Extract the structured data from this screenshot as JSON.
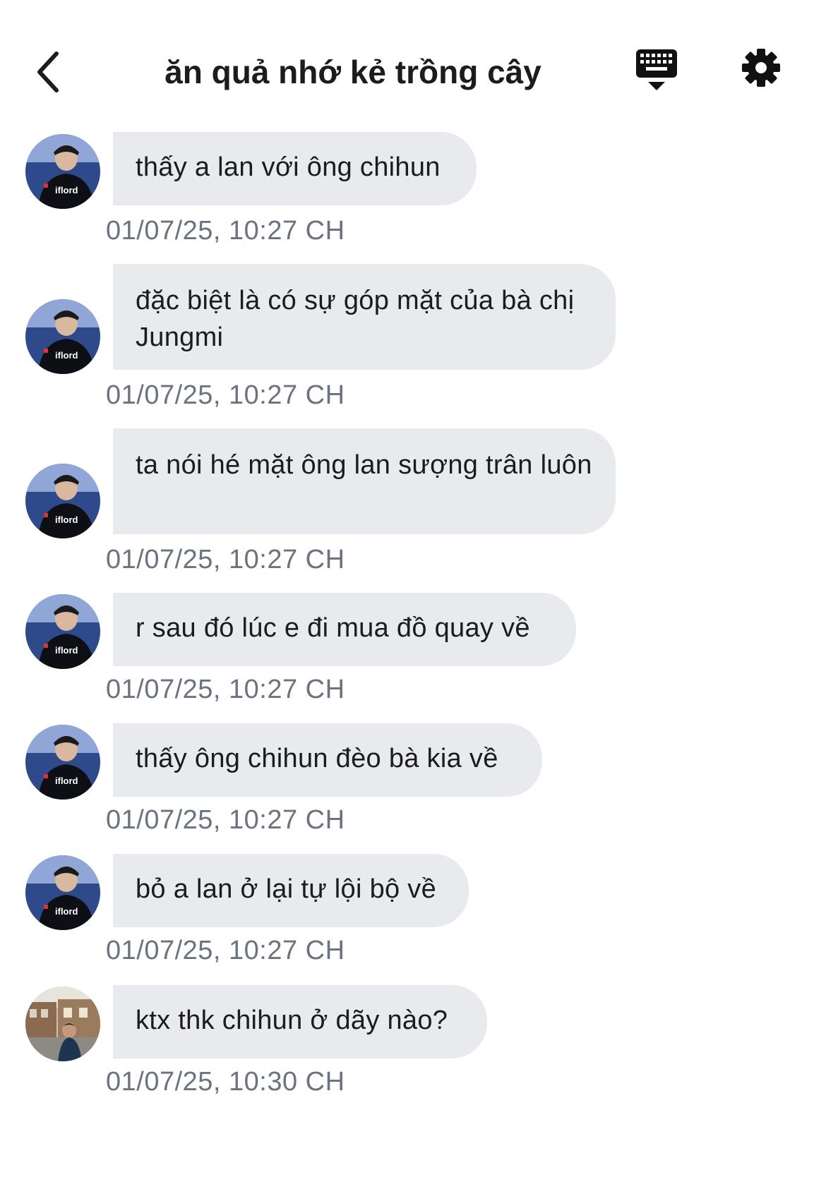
{
  "header": {
    "title": "ăn quả nhớ kẻ trồng cây",
    "back_icon": "chevron-left-icon",
    "keyboard_icon": "keyboard-icon",
    "settings_icon": "gear-icon"
  },
  "messages": [
    {
      "text": "thấy a lan với ông chihun",
      "time": "01/07/25, 10:27 CH",
      "avatar": "avatar-player"
    },
    {
      "text": "đặc biệt là có sự góp mặt của bà chị Jungmi",
      "time": "01/07/25, 10:27 CH",
      "avatar": "avatar-player"
    },
    {
      "text": "ta nói hé mặt ông lan sượng trân luôn",
      "time": "01/07/25, 10:27 CH",
      "avatar": "avatar-player"
    },
    {
      "text": "r sau đó lúc e đi mua đồ quay về",
      "time": "01/07/25, 10:27 CH",
      "avatar": "avatar-player"
    },
    {
      "text": "thấy ông chihun đèo bà kia về",
      "time": "01/07/25, 10:27 CH",
      "avatar": "avatar-player"
    },
    {
      "text": "bỏ a lan ở lại tự lội bộ về",
      "time": "01/07/25, 10:27 CH",
      "avatar": "avatar-player"
    },
    {
      "text": "ktx thk chihun ở dãy nào?",
      "time": "01/07/25, 10:30 CH",
      "avatar": "avatar-street"
    }
  ],
  "colors": {
    "bubble": "#e9eaee",
    "timestamp": "#6b7280",
    "text": "#1c1c1e"
  }
}
